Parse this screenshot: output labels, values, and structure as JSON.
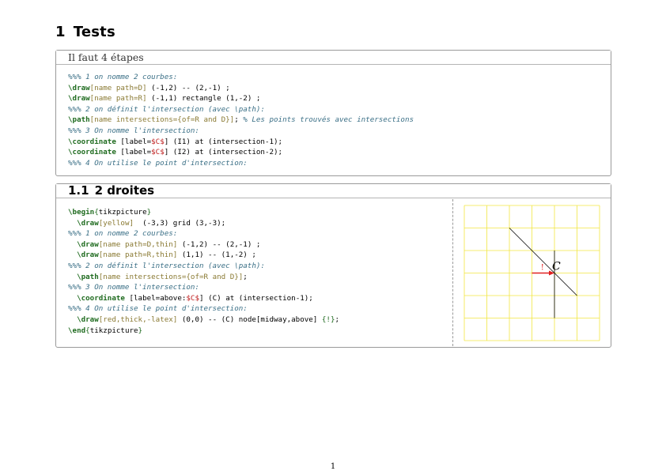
{
  "section": {
    "number": "1",
    "title": "Tests"
  },
  "box1": {
    "title": "Il faut 4 étapes",
    "lines": [
      [
        {
          "t": "%%% 1 on nomme 2 courbes:",
          "c": "cmt"
        }
      ],
      [
        {
          "t": "\\draw",
          "c": "kw"
        },
        {
          "t": "[name path=D]",
          "c": "opt"
        },
        {
          "t": " (-1,2) -- (2,-1) ;",
          "c": ""
        }
      ],
      [
        {
          "t": "\\draw",
          "c": "kw"
        },
        {
          "t": "[name path=R]",
          "c": "opt"
        },
        {
          "t": " (-1,1) rectangle (1,-2) ;",
          "c": ""
        }
      ],
      [
        {
          "t": "%%% 2 on définit l'intersection (avec \\path):",
          "c": "cmt"
        }
      ],
      [
        {
          "t": "\\path",
          "c": "kw"
        },
        {
          "t": "[name intersections={of=R and D}]",
          "c": "opt"
        },
        {
          "t": "; ",
          "c": ""
        },
        {
          "t": "% Les points trouvés avec intersections",
          "c": "cmt"
        }
      ],
      [
        {
          "t": "%%% 3 On nomme l'intersection:",
          "c": "cmt"
        }
      ],
      [
        {
          "t": "\\coordinate",
          "c": "kw"
        },
        {
          "t": " [label=",
          "c": ""
        },
        {
          "t": "$C$",
          "c": "math"
        },
        {
          "t": "] (I1) at (intersection-1);",
          "c": ""
        }
      ],
      [
        {
          "t": "\\coordinate",
          "c": "kw"
        },
        {
          "t": " [label=",
          "c": ""
        },
        {
          "t": "$C$",
          "c": "math"
        },
        {
          "t": "] (I2) at (intersection-2);",
          "c": ""
        }
      ],
      [
        {
          "t": "%%% 4 On utilise le point d'intersection:",
          "c": "cmt"
        }
      ]
    ]
  },
  "subsection": {
    "number": "1.1",
    "title": "2 droites"
  },
  "box2": {
    "lines": [
      [
        {
          "t": "\\begin",
          "c": "kw"
        },
        {
          "t": "{",
          "c": "env"
        },
        {
          "t": "tikzpicture",
          "c": ""
        },
        {
          "t": "}",
          "c": "env"
        }
      ],
      [
        {
          "t": "  ",
          "c": ""
        },
        {
          "t": "\\draw",
          "c": "kw"
        },
        {
          "t": "[yellow]",
          "c": "opt"
        },
        {
          "t": "  (-3,3) grid (3,-3);",
          "c": ""
        }
      ],
      [
        {
          "t": "%%% 1 on nomme 2 courbes:",
          "c": "cmt"
        }
      ],
      [
        {
          "t": "  ",
          "c": ""
        },
        {
          "t": "\\draw",
          "c": "kw"
        },
        {
          "t": "[name path=D,thin]",
          "c": "opt"
        },
        {
          "t": " (-1,2) -- (2,-1) ;",
          "c": ""
        }
      ],
      [
        {
          "t": "  ",
          "c": ""
        },
        {
          "t": "\\draw",
          "c": "kw"
        },
        {
          "t": "[name path=R,thin]",
          "c": "opt"
        },
        {
          "t": " (1,1) -- (1,-2) ;",
          "c": ""
        }
      ],
      [
        {
          "t": "%%% 2 on définit l'intersection (avec \\path):",
          "c": "cmt"
        }
      ],
      [
        {
          "t": "  ",
          "c": ""
        },
        {
          "t": "\\path",
          "c": "kw"
        },
        {
          "t": "[name intersections={of=R and D}]",
          "c": "opt"
        },
        {
          "t": ";",
          "c": ""
        }
      ],
      [
        {
          "t": "%%% 3 On nomme l'intersection:",
          "c": "cmt"
        }
      ],
      [
        {
          "t": "  ",
          "c": ""
        },
        {
          "t": "\\coordinate",
          "c": "kw"
        },
        {
          "t": " [label=above:",
          "c": ""
        },
        {
          "t": "$C$",
          "c": "math"
        },
        {
          "t": "] (C) at (intersection-1);",
          "c": ""
        }
      ],
      [
        {
          "t": "%%% 4 On utilise le point d'intersection:",
          "c": "cmt"
        }
      ],
      [
        {
          "t": "  ",
          "c": ""
        },
        {
          "t": "\\draw",
          "c": "kw"
        },
        {
          "t": "[red,thick,-latex]",
          "c": "opt"
        },
        {
          "t": " (0,0) -- (C) node[midway,above] ",
          "c": ""
        },
        {
          "t": "{!}",
          "c": "env"
        },
        {
          "t": ";",
          "c": ""
        }
      ],
      [
        {
          "t": "\\end",
          "c": "kw"
        },
        {
          "t": "{",
          "c": "env"
        },
        {
          "t": "tikzpicture",
          "c": ""
        },
        {
          "t": "}",
          "c": "env"
        }
      ]
    ],
    "figure": {
      "grid_color": "#f2e640",
      "arrow_color": "#e02020",
      "point_label": "C",
      "arrow_label": "!"
    }
  },
  "page_number": "1"
}
